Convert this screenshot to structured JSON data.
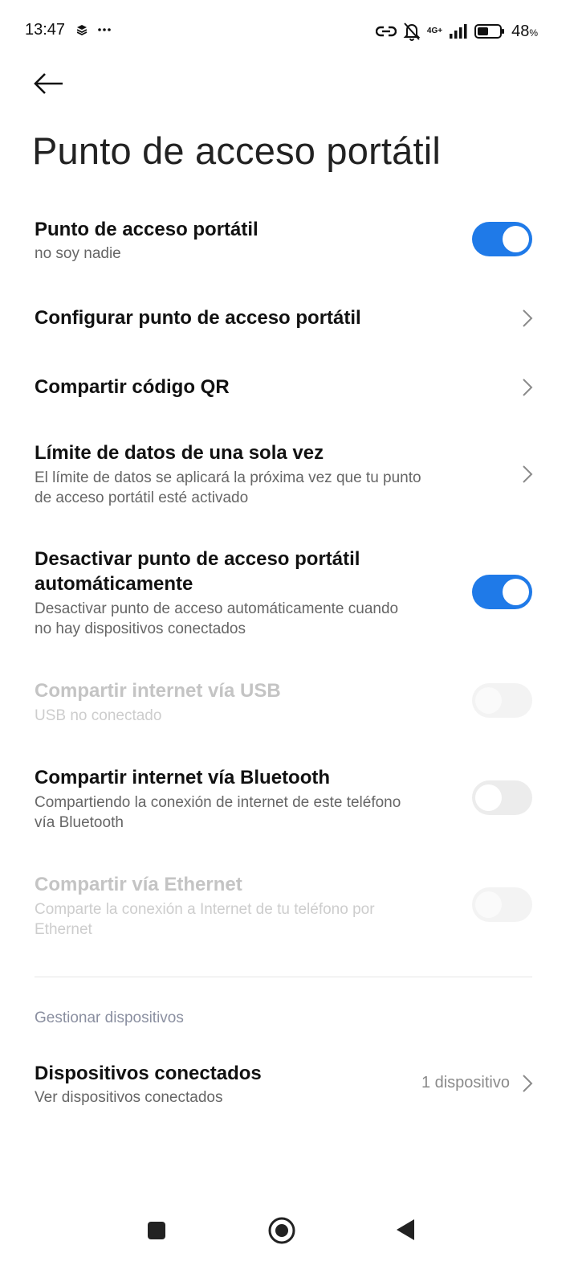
{
  "status_bar": {
    "time": "13:47",
    "left_icons": [
      "layers-icon",
      "more-dots-icon"
    ],
    "right_icons": [
      "hotspot-link-icon",
      "bell-off-icon",
      "network-4g-icon",
      "signal-icon",
      "battery-icon"
    ],
    "network_type": "4G+",
    "battery_value": "48",
    "battery_unit": "%"
  },
  "header": {
    "back_icon": "arrow-left-icon",
    "title": "Punto de acceso portátil"
  },
  "settings": {
    "hotspot": {
      "title": "Punto de acceso portátil",
      "subtitle": "no soy nadie",
      "enabled": true
    },
    "configure": {
      "title": "Configurar punto de acceso portátil"
    },
    "share_qr": {
      "title": "Compartir código QR"
    },
    "data_limit": {
      "title": "Límite de datos de una sola vez",
      "subtitle_line1": "El límite de datos se aplicará la próxima vez que tu punto",
      "subtitle_line2": "de acceso portátil esté activado"
    },
    "auto_off": {
      "title_line1": "Desactivar punto de acceso portátil",
      "title_line2": "automáticamente",
      "subtitle_line1": "Desactivar punto de acceso automáticamente cuando",
      "subtitle_line2": "no hay dispositivos conectados",
      "enabled": true
    },
    "usb_tethering": {
      "title": "Compartir internet vía USB",
      "subtitle": "USB no conectado",
      "enabled": false,
      "disabled": true
    },
    "bt_tethering": {
      "title": "Compartir internet vía Bluetooth",
      "subtitle_line1": "Compartiendo la conexión de internet de este teléfono",
      "subtitle_line2": "vía Bluetooth",
      "enabled": false
    },
    "ethernet": {
      "title": "Compartir vía Ethernet",
      "subtitle_line1": "Comparte la conexión a Internet de tu teléfono por",
      "subtitle_line2": "Ethernet",
      "enabled": false,
      "disabled": true
    }
  },
  "devices_section": {
    "header": "Gestionar dispositivos",
    "connected": {
      "title": "Dispositivos conectados",
      "subtitle": "Ver dispositivos conectados",
      "value": "1 dispositivo"
    }
  },
  "nav_bar": {
    "buttons": [
      "recents-square-icon",
      "home-circle-icon",
      "back-triangle-icon"
    ]
  },
  "colors": {
    "accent": "#1f7ae8",
    "toggle_off": "#ececec",
    "disabled_text": "#c4c4c4",
    "secondary_text": "#666666",
    "section_header": "#8a8fa0"
  }
}
